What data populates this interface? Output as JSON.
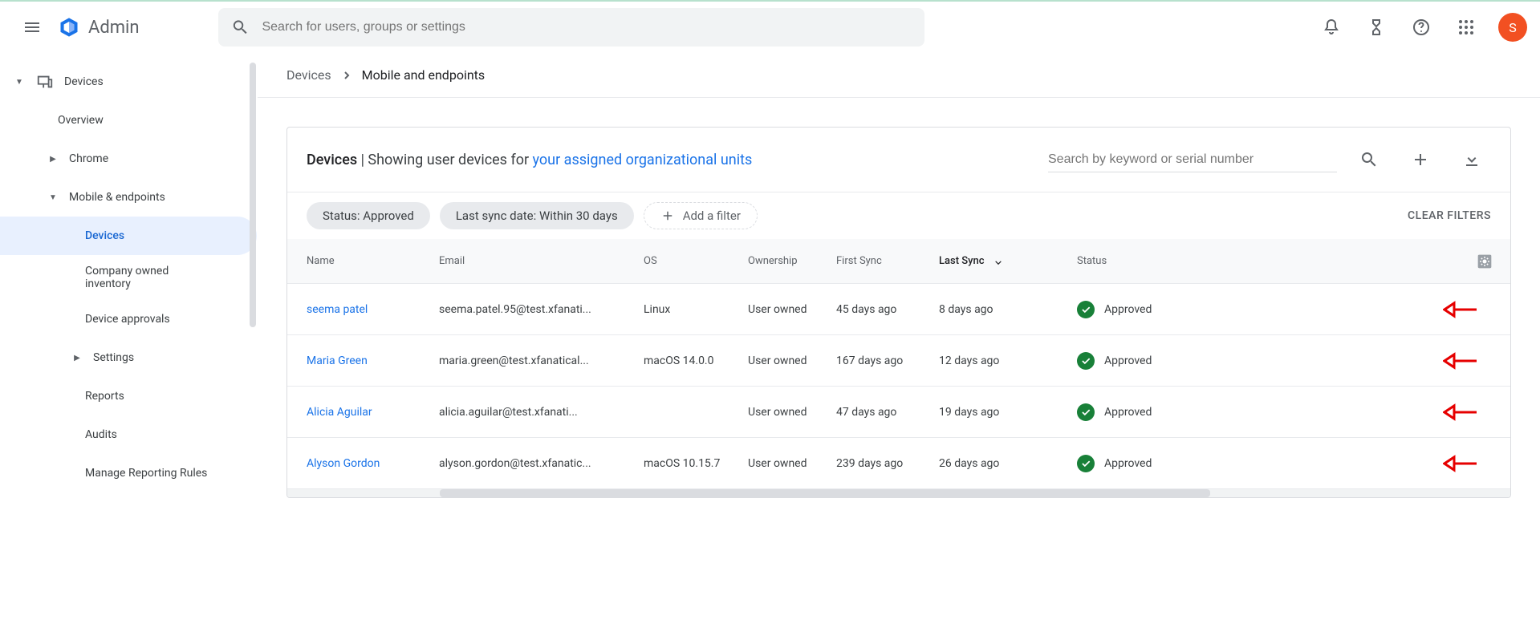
{
  "header": {
    "logo_text": "Admin",
    "search_placeholder": "Search for users, groups or settings",
    "avatar_letter": "S"
  },
  "sidebar": {
    "root_label": "Devices",
    "items": [
      {
        "label": "Overview"
      },
      {
        "label": "Chrome"
      },
      {
        "label": "Mobile & endpoints"
      },
      {
        "label": "Devices"
      },
      {
        "label": "Company owned inventory"
      },
      {
        "label": "Device approvals"
      },
      {
        "label": "Settings"
      },
      {
        "label": "Reports"
      },
      {
        "label": "Audits"
      },
      {
        "label": "Manage Reporting Rules"
      }
    ]
  },
  "breadcrumb": {
    "root": "Devices",
    "current": "Mobile and endpoints"
  },
  "panel": {
    "title_prefix": "Devices",
    "title_mid": " | Showing user devices for ",
    "title_link": "your assigned organizational units",
    "search_placeholder": "Search by keyword or serial number"
  },
  "filters": {
    "chip_status": "Status: Approved",
    "chip_last_sync": "Last sync date: Within 30 days",
    "add_filter": "Add a filter",
    "clear": "CLEAR FILTERS"
  },
  "table": {
    "headers": {
      "name": "Name",
      "email": "Email",
      "os": "OS",
      "ownership": "Ownership",
      "first_sync": "First Sync",
      "last_sync": "Last Sync",
      "status": "Status"
    },
    "rows": [
      {
        "name": "seema patel",
        "email": "seema.patel.95@test.xfanati...",
        "os": "Linux",
        "ownership": "User owned",
        "first_sync": "45 days ago",
        "last_sync": "8 days ago",
        "status": "Approved"
      },
      {
        "name": "Maria Green",
        "email": "maria.green@test.xfanatical...",
        "os": "macOS 14.0.0",
        "ownership": "User owned",
        "first_sync": "167 days ago",
        "last_sync": "12 days ago",
        "status": "Approved"
      },
      {
        "name": "Alicia Aguilar",
        "email": "alicia.aguilar@test.xfanati...",
        "os": "",
        "ownership": "User owned",
        "first_sync": "47 days ago",
        "last_sync": "19 days ago",
        "status": "Approved"
      },
      {
        "name": "Alyson Gordon",
        "email": "alyson.gordon@test.xfanatic...",
        "os": "macOS 10.15.7",
        "ownership": "User owned",
        "first_sync": "239 days ago",
        "last_sync": "26 days ago",
        "status": "Approved"
      }
    ]
  }
}
